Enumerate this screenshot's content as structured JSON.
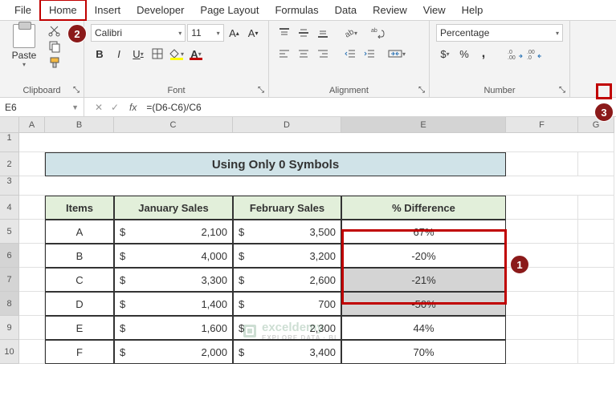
{
  "menu": {
    "items": [
      "File",
      "Home",
      "Insert",
      "Developer",
      "Page Layout",
      "Formulas",
      "Data",
      "Review",
      "View",
      "Help"
    ],
    "active_index": 1
  },
  "ribbon": {
    "clipboard": {
      "label": "Clipboard",
      "paste": "Paste"
    },
    "font": {
      "label": "Font",
      "family": "Calibri",
      "size": "11",
      "bold": "B",
      "italic": "I",
      "underline": "U"
    },
    "alignment": {
      "label": "Alignment"
    },
    "number": {
      "label": "Number",
      "format": "Percentage",
      "currency": "$",
      "percent": "%",
      "comma": ","
    }
  },
  "formula_bar": {
    "name_box": "E6",
    "fx": "fx",
    "formula": "=(D6-C6)/C6"
  },
  "columns": [
    "",
    "A",
    "B",
    "C",
    "D",
    "E",
    "F",
    "G"
  ],
  "rows": [
    "1",
    "2",
    "3",
    "4",
    "5",
    "6",
    "7",
    "8",
    "9",
    "10"
  ],
  "sheet": {
    "title": "Using Only 0 Symbols",
    "headers": {
      "items": "Items",
      "jan": "January Sales",
      "feb": "February Sales",
      "diff": "% Difference"
    },
    "data": [
      {
        "item": "A",
        "jan": "2,100",
        "feb": "3,500",
        "diff": "67%"
      },
      {
        "item": "B",
        "jan": "4,000",
        "feb": "3,200",
        "diff": "-20%"
      },
      {
        "item": "C",
        "jan": "3,300",
        "feb": "2,600",
        "diff": "-21%"
      },
      {
        "item": "D",
        "jan": "1,400",
        "feb": "700",
        "diff": "-50%"
      },
      {
        "item": "E",
        "jan": "1,600",
        "feb": "2,300",
        "diff": "44%"
      },
      {
        "item": "F",
        "jan": "2,000",
        "feb": "3,400",
        "diff": "70%"
      }
    ],
    "currency_symbol": "$"
  },
  "annotations": {
    "n1": "1",
    "n2": "2",
    "n3": "3"
  },
  "watermark": {
    "main": "exceldemy",
    "sub": "EXPLORE DATA · BI"
  }
}
